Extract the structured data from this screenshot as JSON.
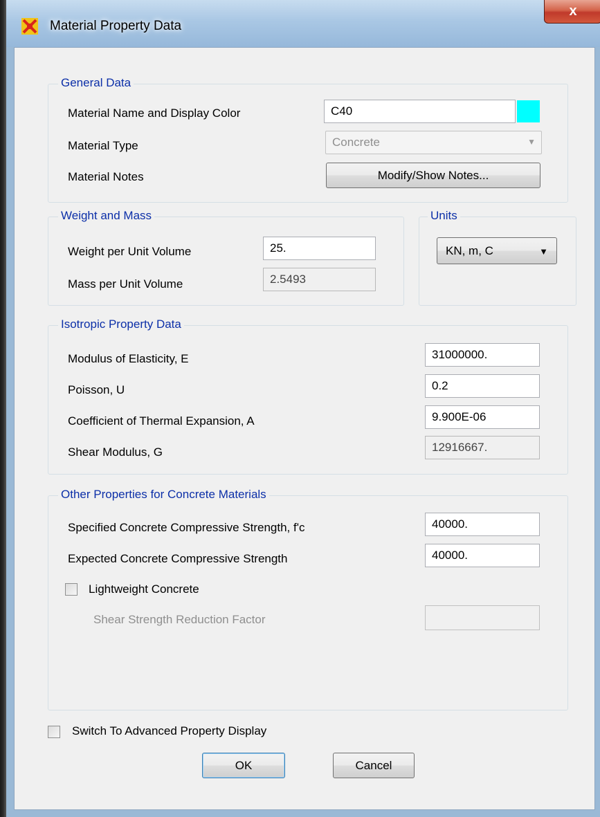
{
  "window": {
    "title": "Material Property Data",
    "close_glyph": "x"
  },
  "general": {
    "title": "General Data",
    "name_label": "Material Name and Display Color",
    "name_value": "C40",
    "display_color": "#00ffff",
    "type_label": "Material Type",
    "type_value": "Concrete",
    "notes_label": "Material Notes",
    "notes_button": "Modify/Show Notes..."
  },
  "weight_mass": {
    "title": "Weight and Mass",
    "weight_label": "Weight per Unit Volume",
    "weight_value": "25.",
    "mass_label": "Mass per Unit Volume",
    "mass_value": "2.5493"
  },
  "units": {
    "title": "Units",
    "value": "KN, m, C"
  },
  "isotropic": {
    "title": "Isotropic Property Data",
    "e_label": "Modulus of Elasticity,  E",
    "e_value": "31000000.",
    "u_label": "Poisson,  U",
    "u_value": "0.2",
    "a_label": "Coefficient of Thermal Expansion,  A",
    "a_value": "9.900E-06",
    "g_label": "Shear Modulus,  G",
    "g_value": "12916667."
  },
  "concrete": {
    "title": "Other Properties for Concrete Materials",
    "fc_label": "Specified Concrete Compressive Strength, f'c",
    "fc_value": "40000.",
    "expected_label": "Expected Concrete Compressive Strength",
    "expected_value": "40000.",
    "lightweight_label": "Lightweight Concrete",
    "shear_reduction_label": "Shear Strength Reduction Factor",
    "shear_reduction_value": ""
  },
  "advanced_label": "Switch To Advanced Property Display",
  "ok_label": "OK",
  "cancel_label": "Cancel"
}
